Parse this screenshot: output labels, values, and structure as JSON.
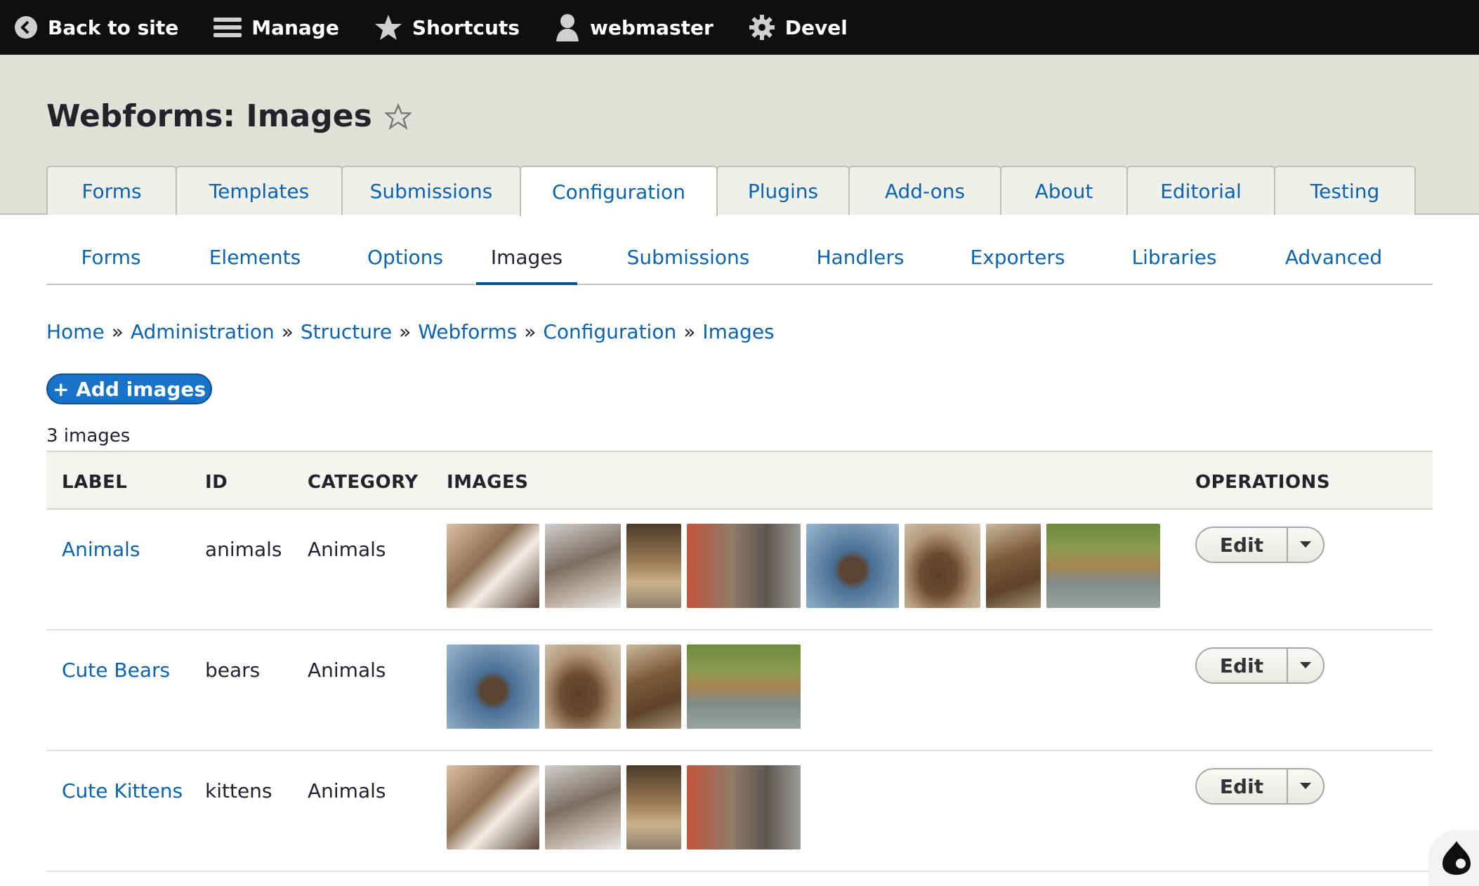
{
  "toolbar": {
    "items": [
      {
        "label": "Back to site",
        "icon": "arrow-left-circle-icon"
      },
      {
        "label": "Manage",
        "icon": "hamburger-menu-icon"
      },
      {
        "label": "Shortcuts",
        "icon": "star-icon"
      },
      {
        "label": "webmaster",
        "icon": "user-icon"
      },
      {
        "label": "Devel",
        "icon": "gear-icon"
      }
    ]
  },
  "page": {
    "title": "Webforms: Images",
    "count": "3 images",
    "add_button": "+ Add images"
  },
  "primary_tabs": [
    {
      "label": "Forms"
    },
    {
      "label": "Templates"
    },
    {
      "label": "Submissions"
    },
    {
      "label": "Configuration",
      "active": true
    },
    {
      "label": "Plugins"
    },
    {
      "label": "Add-ons"
    },
    {
      "label": "About"
    },
    {
      "label": "Editorial"
    },
    {
      "label": "Testing"
    }
  ],
  "secondary_tabs": [
    {
      "label": "Forms"
    },
    {
      "label": "Elements"
    },
    {
      "label": "Options"
    },
    {
      "label": "Images",
      "active": true
    },
    {
      "label": "Submissions"
    },
    {
      "label": "Handlers"
    },
    {
      "label": "Exporters"
    },
    {
      "label": "Libraries"
    },
    {
      "label": "Advanced"
    }
  ],
  "breadcrumb": {
    "items": [
      "Home",
      "Administration",
      "Structure",
      "Webforms",
      "Configuration",
      "Images"
    ],
    "separator": "»"
  },
  "table": {
    "headers": {
      "label": "LABEL",
      "id": "ID",
      "category": "CATEGORY",
      "images": "IMAGES",
      "operations": "OPERATIONS"
    },
    "rows": [
      {
        "label": "Animals",
        "id": "animals",
        "category": "Animals",
        "edit": "Edit",
        "images": [
          "kitten-1",
          "kitten-2",
          "kitten-3",
          "kitten-4",
          "bear-1",
          "bear-2",
          "bear-3",
          "bear-4"
        ]
      },
      {
        "label": "Cute Bears",
        "id": "bears",
        "category": "Animals",
        "edit": "Edit",
        "images": [
          "bear-1",
          "bear-2",
          "bear-3",
          "bear-4"
        ]
      },
      {
        "label": "Cute Kittens",
        "id": "kittens",
        "category": "Animals",
        "edit": "Edit",
        "images": [
          "kitten-1",
          "kitten-2",
          "kitten-3",
          "kitten-4"
        ]
      }
    ]
  },
  "colors": {
    "link": "#0b63b0",
    "toolbar_bg": "#0f0f0f",
    "header_bg": "#e0e0d8",
    "button_primary": "#1673c8"
  }
}
